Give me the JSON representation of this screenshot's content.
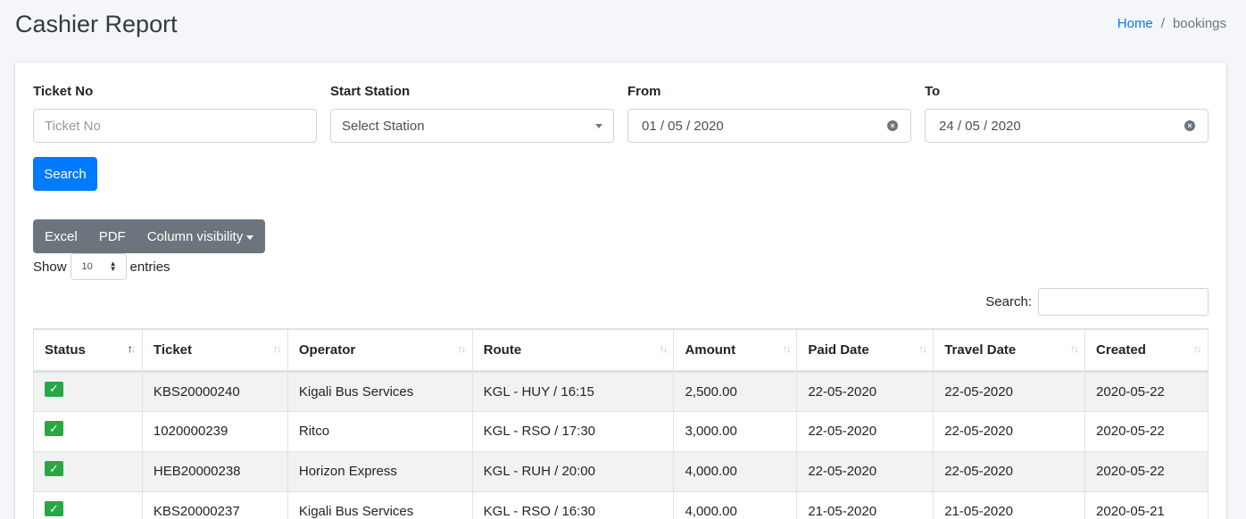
{
  "page": {
    "title": "Cashier Report",
    "breadcrumb": {
      "home": "Home",
      "separator": "/",
      "current": "bookings"
    }
  },
  "filters": {
    "ticket_no": {
      "label": "Ticket No",
      "placeholder": "Ticket No",
      "value": ""
    },
    "start_station": {
      "label": "Start Station",
      "value": "Select Station"
    },
    "from": {
      "label": "From",
      "value": "01 / 05 / 2020"
    },
    "to": {
      "label": "To",
      "value": "24 / 05 / 2020"
    },
    "search_button": "Search"
  },
  "toolbar": {
    "excel": "Excel",
    "pdf": "PDF",
    "column_visibility": "Column visibility"
  },
  "length_menu": {
    "show": "Show",
    "value": "10",
    "entries": "entries"
  },
  "table_search": {
    "label": "Search:",
    "value": ""
  },
  "table": {
    "columns": [
      "Status",
      "Ticket",
      "Operator",
      "Route",
      "Amount",
      "Paid Date",
      "Travel Date",
      "Created"
    ],
    "sorted_column": "Status",
    "rows": [
      {
        "status": "check-icon",
        "ticket": "KBS20000240",
        "operator": "Kigali Bus Services",
        "route": "KGL - HUY / 16:15",
        "amount": "2,500.00",
        "paid_date": "22-05-2020",
        "travel_date": "22-05-2020",
        "created": "2020-05-22"
      },
      {
        "status": "check-icon",
        "ticket": "1020000239",
        "operator": "Ritco",
        "route": "KGL - RSO / 17:30",
        "amount": "3,000.00",
        "paid_date": "22-05-2020",
        "travel_date": "22-05-2020",
        "created": "2020-05-22"
      },
      {
        "status": "check-icon",
        "ticket": "HEB20000238",
        "operator": "Horizon Express",
        "route": "KGL - RUH / 20:00",
        "amount": "4,000.00",
        "paid_date": "22-05-2020",
        "travel_date": "22-05-2020",
        "created": "2020-05-22"
      },
      {
        "status": "check-icon",
        "ticket": "KBS20000237",
        "operator": "Kigali Bus Services",
        "route": "KGL - RSO / 16:30",
        "amount": "4,000.00",
        "paid_date": "21-05-2020",
        "travel_date": "21-05-2020",
        "created": "2020-05-21"
      }
    ]
  },
  "colors": {
    "primary": "#007bff",
    "secondary": "#6c757d",
    "success": "#28a745"
  }
}
